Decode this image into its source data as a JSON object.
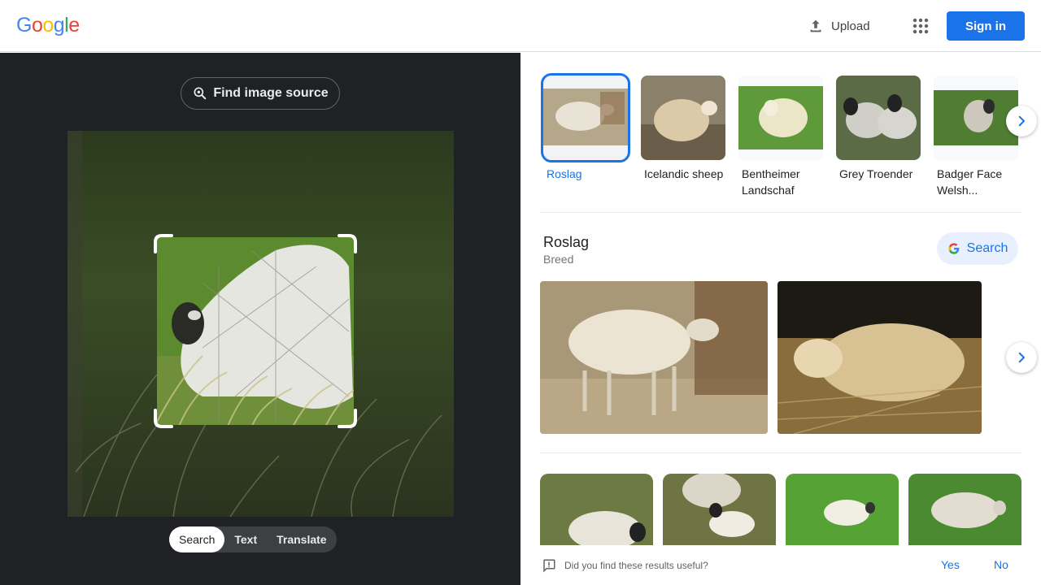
{
  "header": {
    "logo_letters": [
      {
        "ch": "G",
        "color": "#4285F4"
      },
      {
        "ch": "o",
        "color": "#EA4335"
      },
      {
        "ch": "o",
        "color": "#FBBC05"
      },
      {
        "ch": "g",
        "color": "#4285F4"
      },
      {
        "ch": "l",
        "color": "#34A853"
      },
      {
        "ch": "e",
        "color": "#EA4335"
      }
    ],
    "upload_label": "Upload",
    "apps_icon": "apps-grid-icon",
    "signin_label": "Sign in"
  },
  "left": {
    "find_source_label": "Find image source",
    "tabs": [
      {
        "label": "Search",
        "active": true
      },
      {
        "label": "Text",
        "active": false
      },
      {
        "label": "Translate",
        "active": false
      }
    ]
  },
  "suggestions": [
    {
      "label": "Roslag",
      "selected": true
    },
    {
      "label": "Icelandic sheep",
      "selected": false
    },
    {
      "label": "Bentheimer Landschaf",
      "selected": false
    },
    {
      "label": "Grey Troender",
      "selected": false
    },
    {
      "label": "Badger Face Welsh..."
    }
  ],
  "entity": {
    "title": "Roslag",
    "subtitle": "Breed",
    "search_label": "Search"
  },
  "feedback": {
    "question": "Did you find these results useful?",
    "yes": "Yes",
    "no": "No"
  },
  "colors": {
    "accent": "#1a73e8",
    "left_bg": "#202124"
  }
}
